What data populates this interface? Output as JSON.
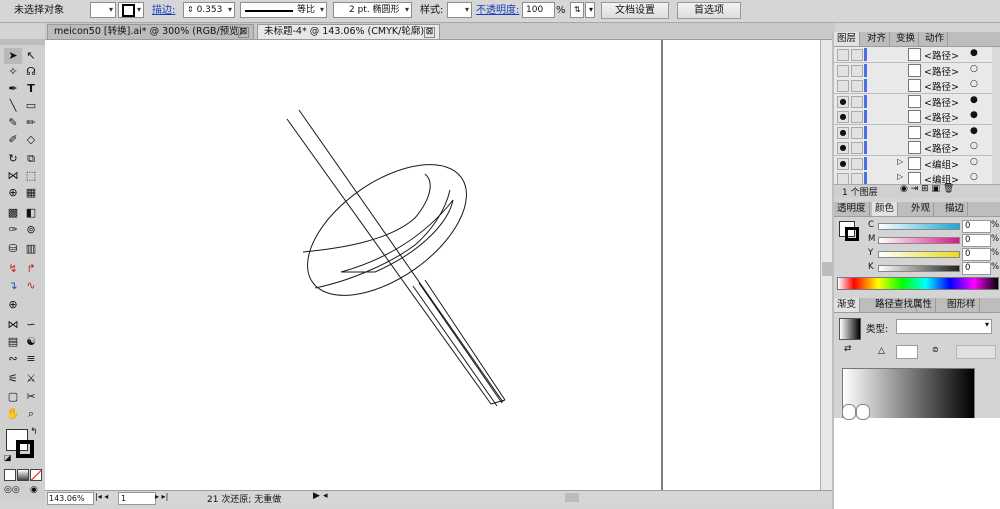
{
  "control_bar": {
    "selection_label": "未选择对象",
    "stroke_link": "描边:",
    "stroke_value": "0.353",
    "stroke_profile": "等比",
    "brush_label": "2 pt. 椭圆形",
    "style_label": "样式:",
    "opacity_link": "不透明度:",
    "opacity_value": "100",
    "opacity_unit": "%",
    "doc_setup_button": "文档设置",
    "preferences_button": "首选项"
  },
  "tabs": [
    {
      "label": "meicon50 [转换].ai* @ 300% (RGB/预览)",
      "close": "⊠"
    },
    {
      "label": "未标题-4* @ 143.06% (CMYK/轮廓)",
      "close": "⊠"
    }
  ],
  "layers_panel": {
    "tabs": [
      "图层",
      "对齐",
      "变换",
      "动作"
    ],
    "rows": [
      {
        "label": "<路径>",
        "visible": false,
        "target": "filled"
      },
      {
        "label": "<路径>",
        "visible": false,
        "target": "open"
      },
      {
        "label": "<路径>",
        "visible": false,
        "target": "open"
      },
      {
        "label": "<路径>",
        "visible": true,
        "target": "filled"
      },
      {
        "label": "<路径>",
        "visible": true,
        "target": "filled"
      },
      {
        "label": "<路径>",
        "visible": true,
        "target": "filled"
      },
      {
        "label": "<路径>",
        "visible": true,
        "target": "open"
      },
      {
        "label": "<编组>",
        "visible": true,
        "target": "open"
      },
      {
        "label": "<编组>",
        "visible": false,
        "target": "open"
      }
    ],
    "footer_count": "1 个图层"
  },
  "color_panel": {
    "tabs": [
      "透明度",
      "颜色",
      "外观",
      "描边"
    ],
    "sliders": [
      {
        "label": "C",
        "value": "0",
        "unit": "%",
        "color": "#19a8d8"
      },
      {
        "label": "M",
        "value": "0",
        "unit": "%",
        "color": "#d8198a"
      },
      {
        "label": "Y",
        "value": "0",
        "unit": "%",
        "color": "#e8dd18"
      },
      {
        "label": "K",
        "value": "0",
        "unit": "%",
        "color": "#222222"
      }
    ]
  },
  "gradient_panel": {
    "tabs": [
      "渐变",
      "路径查找",
      "属性",
      "图形样"
    ],
    "type_label": "类型:"
  },
  "status_bar": {
    "zoom": "143.06%",
    "artboard": "1",
    "undo_text": "21 次还原; 无重做"
  },
  "colors": {
    "accent_link": "#1a3fb8",
    "panel_bg": "#d4d4d4",
    "canvas_bg": "#ffffff"
  }
}
